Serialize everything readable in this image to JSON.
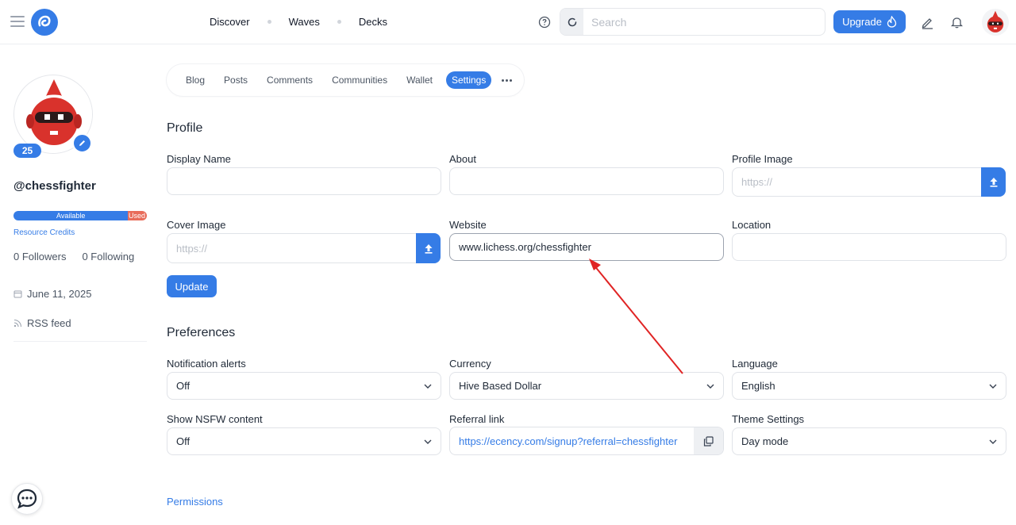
{
  "nav": {
    "links": [
      "Discover",
      "Waves",
      "Decks"
    ],
    "search_placeholder": "Search",
    "upgrade_label": "Upgrade"
  },
  "sidebar": {
    "reputation": "25",
    "username": "@chessfighter",
    "rc_available_label": "Available",
    "rc_used_label": "Used",
    "rc_available_fraction": 0.86,
    "rc_link": "Resource Credits",
    "followers": "0 Followers",
    "following": "0 Following",
    "joined": "June 11, 2025",
    "rss": "RSS feed"
  },
  "tabs": {
    "items": [
      "Blog",
      "Posts",
      "Comments",
      "Communities",
      "Wallet",
      "Settings"
    ],
    "active": "Settings"
  },
  "profile": {
    "title": "Profile",
    "display_name_label": "Display Name",
    "display_name_value": "",
    "about_label": "About",
    "about_value": "",
    "profile_image_label": "Profile Image",
    "profile_image_placeholder": "https://",
    "cover_image_label": "Cover Image",
    "cover_image_placeholder": "https://",
    "website_label": "Website",
    "website_value": "www.lichess.org/chessfighter",
    "location_label": "Location",
    "location_value": "",
    "update_label": "Update"
  },
  "preferences": {
    "title": "Preferences",
    "notification_label": "Notification alerts",
    "notification_value": "Off",
    "currency_label": "Currency",
    "currency_value": "Hive Based Dollar",
    "language_label": "Language",
    "language_value": "English",
    "nsfw_label": "Show NSFW content",
    "nsfw_value": "Off",
    "referral_label": "Referral link",
    "referral_value": "https://ecency.com/signup?referral=chessfighter",
    "theme_label": "Theme Settings",
    "theme_value": "Day mode"
  },
  "permissions_link": "Permissions",
  "colors": {
    "accent": "#357ce6",
    "annotation_arrow": "#e02424"
  }
}
